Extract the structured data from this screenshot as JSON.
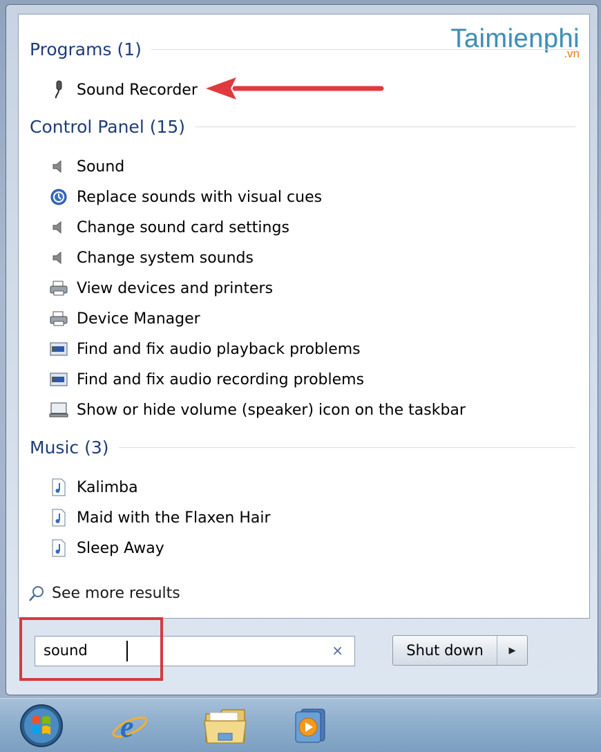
{
  "watermark": {
    "name": "Taimienphi",
    "tld": ".vn"
  },
  "groups": [
    {
      "title": "Programs (1)",
      "items": [
        {
          "label": "Sound Recorder",
          "icon": "microphone-icon"
        }
      ]
    },
    {
      "title": "Control Panel (15)",
      "items": [
        {
          "label": "Sound",
          "icon": "speaker-icon"
        },
        {
          "label": "Replace sounds with visual cues",
          "icon": "ease-of-access-icon"
        },
        {
          "label": "Change sound card settings",
          "icon": "speaker-icon"
        },
        {
          "label": "Change system sounds",
          "icon": "speaker-icon"
        },
        {
          "label": "View devices and printers",
          "icon": "printer-icon"
        },
        {
          "label": "Device Manager",
          "icon": "printer-icon"
        },
        {
          "label": "Find and fix audio playback problems",
          "icon": "troubleshoot-icon"
        },
        {
          "label": "Find and fix audio recording problems",
          "icon": "troubleshoot-icon"
        },
        {
          "label": "Show or hide volume (speaker) icon on the taskbar",
          "icon": "notification-area-icon"
        }
      ]
    },
    {
      "title": "Music (3)",
      "items": [
        {
          "label": "Kalimba",
          "icon": "music-file-icon"
        },
        {
          "label": "Maid with the Flaxen Hair",
          "icon": "music-file-icon"
        },
        {
          "label": "Sleep Away",
          "icon": "music-file-icon"
        }
      ]
    }
  ],
  "see_more": "See more results",
  "search": {
    "value": "sound",
    "clear_icon": "×"
  },
  "shutdown": {
    "label": "Shut down",
    "arrow": "▶"
  },
  "taskbar": {
    "items": [
      "start-orb-icon",
      "internet-explorer-icon",
      "windows-explorer-icon",
      "media-player-icon"
    ]
  },
  "colors": {
    "highlight": "#d43a40",
    "group_title": "#1e3c78",
    "annotation_arrow": "#e03a3e"
  }
}
